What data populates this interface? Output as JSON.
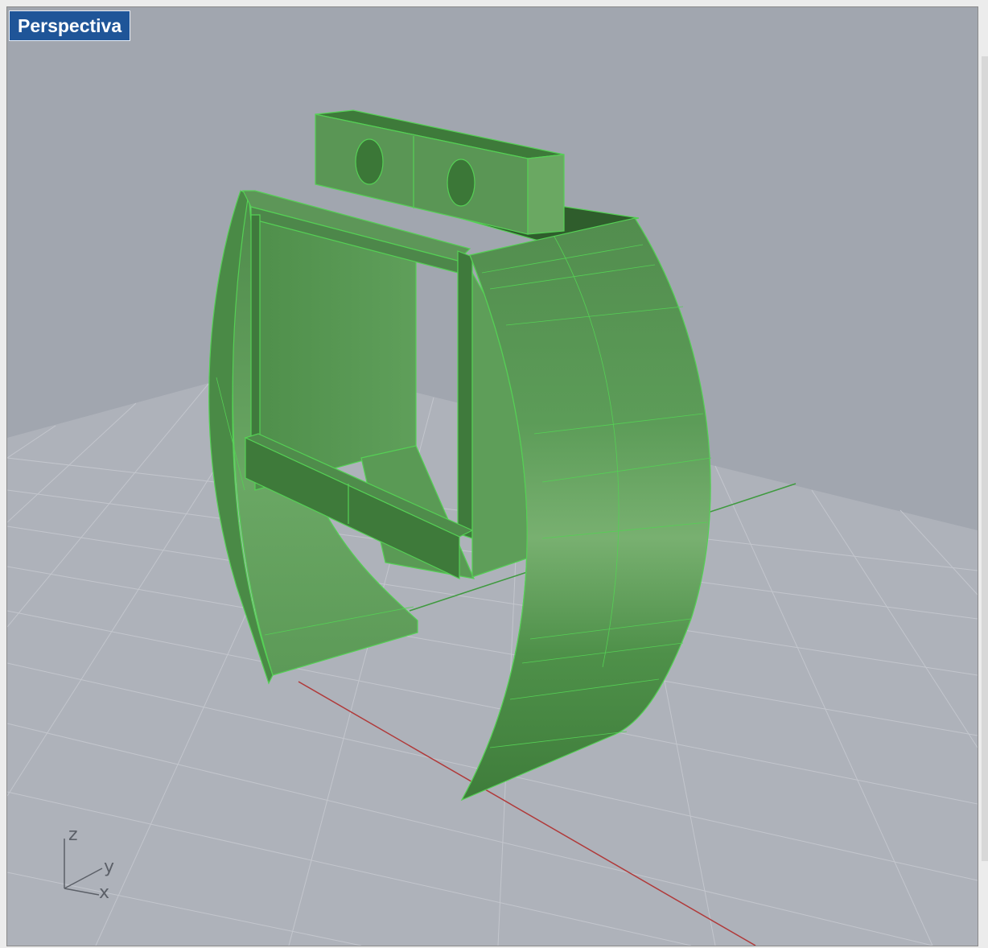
{
  "viewport": {
    "title": "Perspectiva",
    "gizmo": {
      "z_label": "z",
      "y_label": "y",
      "x_label": "x"
    }
  },
  "colors": {
    "background": "#a1a6af",
    "grid_minor": "#b6bac2",
    "grid_major": "#c6c9d0",
    "x_axis": "#b03a3a",
    "y_axis": "#3f9a3f",
    "model_fill": "#5a9c55",
    "model_edge": "#55d055",
    "title_bg": "#1f5598"
  },
  "icons": [
    "axis-gizmo-icon"
  ]
}
